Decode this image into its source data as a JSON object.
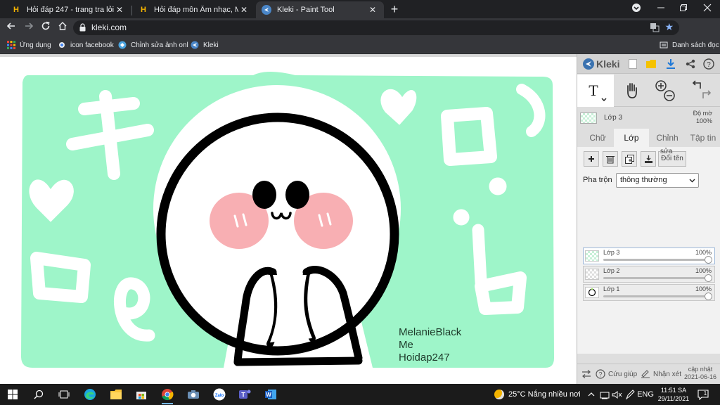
{
  "browser": {
    "tabs": [
      {
        "title": "Hỏi đáp 247 - trang tra lỏi",
        "favicon": "H",
        "active": false
      },
      {
        "title": "Hỏi đáp môn Âm nhạc, Mỹ thuật",
        "favicon": "H",
        "active": false
      },
      {
        "title": "Kleki - Paint Tool",
        "favicon": "kleki-icon",
        "active": true
      }
    ],
    "close_glyph": "✕",
    "new_tab_glyph": "+",
    "url": "kleki.com",
    "profile_initial": "N",
    "bookmarks": [
      {
        "label": "Ứng dụng",
        "icon": "apps-grid-icon"
      },
      {
        "label": "icon facebook",
        "icon": "dot-icon"
      },
      {
        "label": "Chỉnh sửa ảnh onl",
        "icon": "photo-editor-icon"
      },
      {
        "label": "Kleki",
        "icon": "kleki-icon"
      }
    ],
    "reading_list": "Danh sách đọc",
    "colors": {
      "dark": "#202124",
      "toolbar": "#35363a",
      "accent": "#8ab4f8"
    }
  },
  "canvas": {
    "signature": [
      "MelanieBlack",
      "Me",
      "Hoidap247"
    ],
    "colors": {
      "background": "#9ef5c9",
      "outline": "#000000",
      "blush": "#f4a3a8",
      "sprout": "#a6e66b"
    }
  },
  "kleki": {
    "logo": "Kleki",
    "current_layer": {
      "name": "Lớp 3",
      "opacity_label": "Độ mờ",
      "opacity": "100%"
    },
    "tabs": [
      "Chữ",
      "Lớp",
      "Chỉnh",
      "Tập tin"
    ],
    "active_tab": "Lớp",
    "rename_label": "Đổi tên",
    "rename_sup": "sửa",
    "blend_label": "Pha trộn",
    "blend_mode": "thông thường",
    "layers": [
      {
        "name": "Lớp 3",
        "opacity": "100%",
        "selected": true
      },
      {
        "name": "Lớp 2",
        "opacity": "100%",
        "selected": false
      },
      {
        "name": "Lớp 1",
        "opacity": "100%",
        "selected": false
      }
    ],
    "footer": {
      "help": "Cứu giúp",
      "feedback": "Nhận xét",
      "update_label": "cập nhật",
      "update_date": "2021-06-16"
    }
  },
  "taskbar": {
    "weather": "25°C  Nắng nhiều nơi",
    "language": "ENG",
    "time": "11:51 SA",
    "date": "29/11/2021",
    "notification_count": "1"
  }
}
